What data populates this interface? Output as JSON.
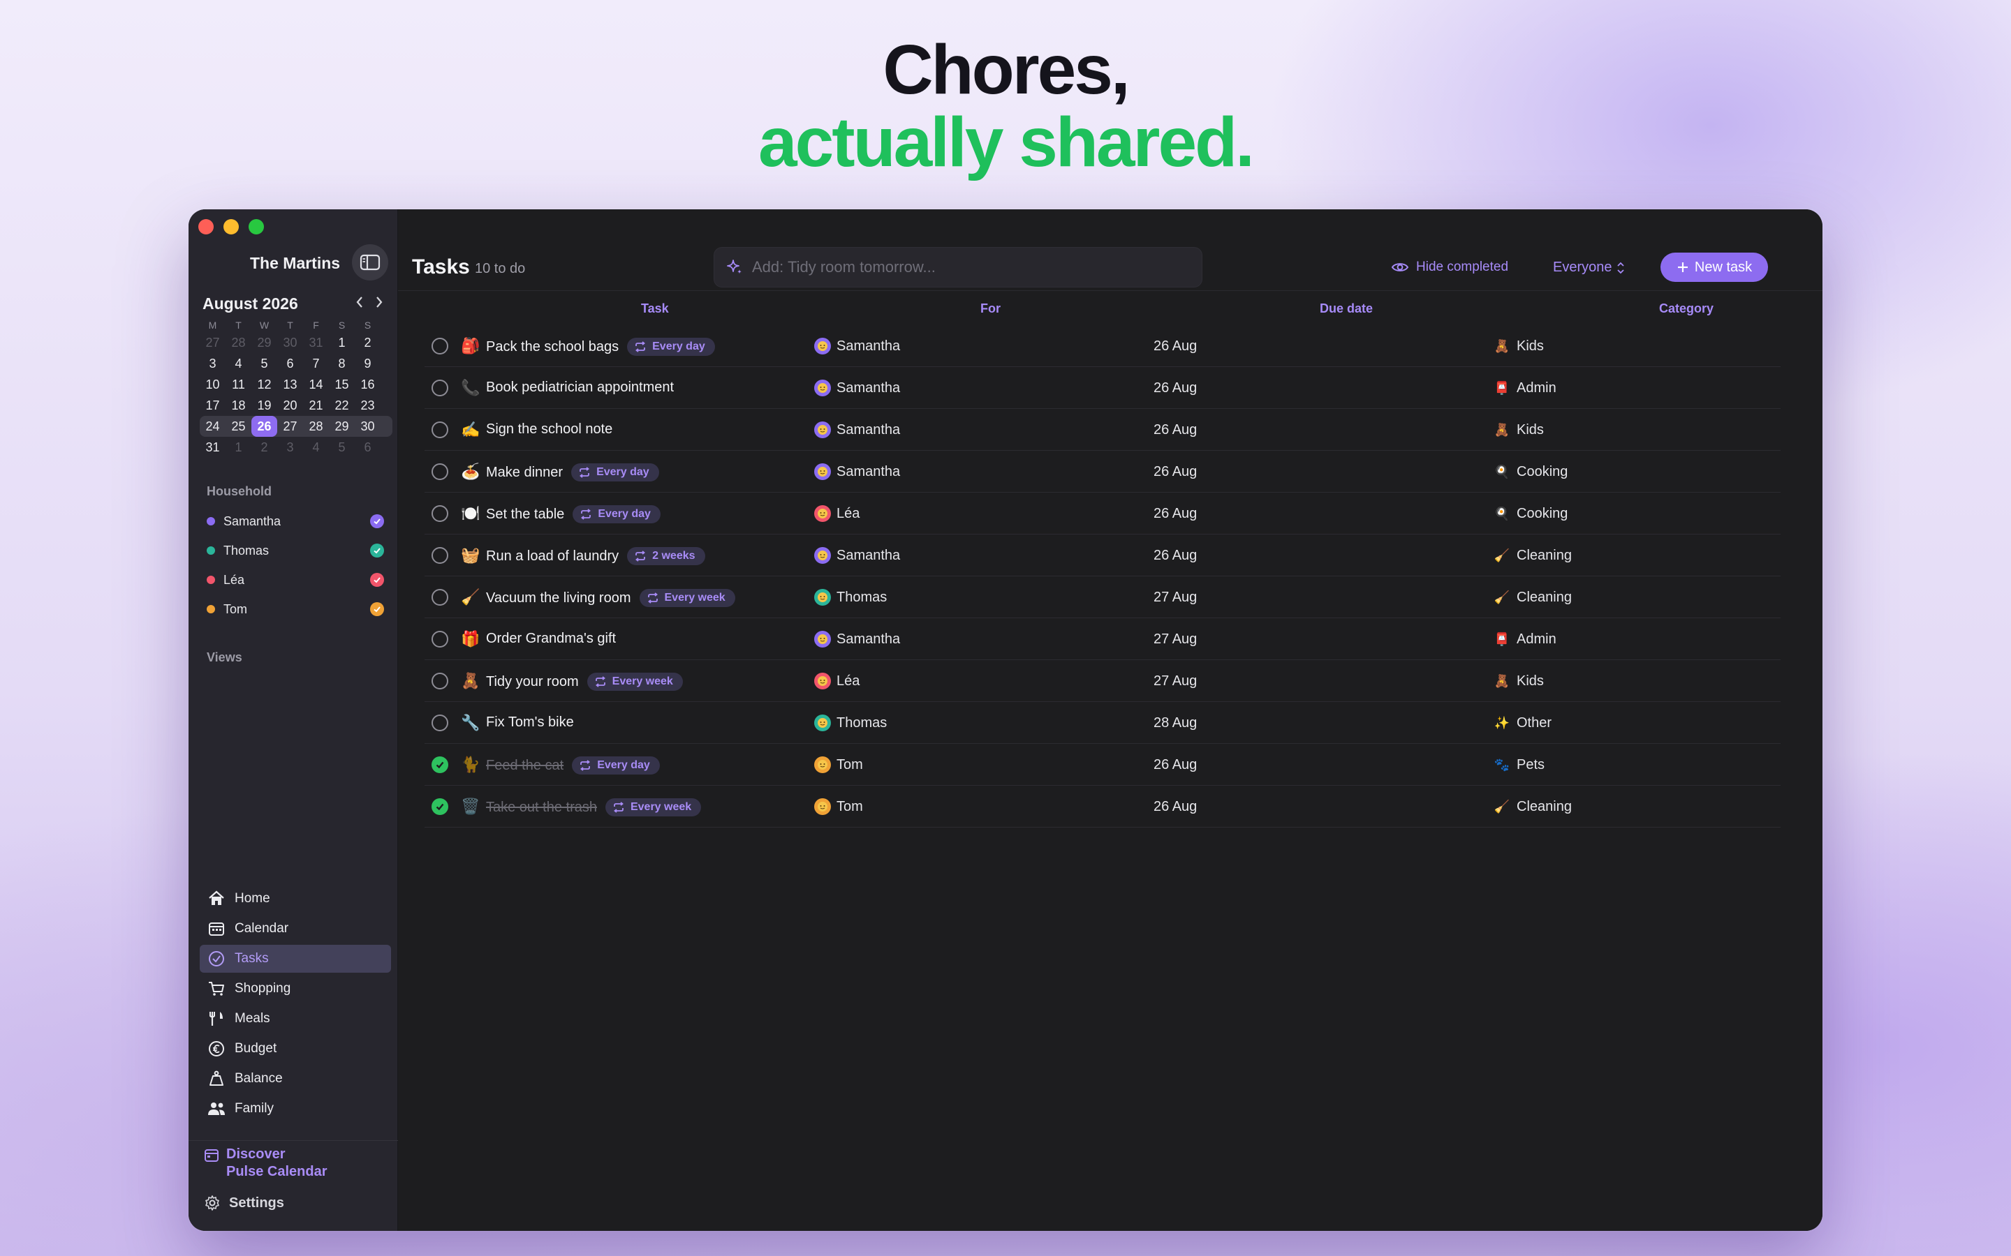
{
  "headline": {
    "line1": "Chores,",
    "line2": "actually shared."
  },
  "sidebar": {
    "household_name": "The Martins",
    "calendar": {
      "month_label": "August 2026",
      "weekdays": [
        "M",
        "T",
        "W",
        "T",
        "F",
        "S",
        "S"
      ],
      "weeks": [
        [
          "27",
          "28",
          "29",
          "30",
          "31",
          "1",
          "2"
        ],
        [
          "3",
          "4",
          "5",
          "6",
          "7",
          "8",
          "9"
        ],
        [
          "10",
          "11",
          "12",
          "13",
          "14",
          "15",
          "16"
        ],
        [
          "17",
          "18",
          "19",
          "20",
          "21",
          "22",
          "23"
        ],
        [
          "24",
          "25",
          "26",
          "27",
          "28",
          "29",
          "30"
        ],
        [
          "31",
          "1",
          "2",
          "3",
          "4",
          "5",
          "6"
        ]
      ],
      "today": "26"
    },
    "household_label": "Household",
    "members": [
      {
        "name": "Samantha",
        "color": "#8b6cf2"
      },
      {
        "name": "Thomas",
        "color": "#2bb59a"
      },
      {
        "name": "Léa",
        "color": "#f2556b"
      },
      {
        "name": "Tom",
        "color": "#f0a236"
      }
    ],
    "views_label": "Views",
    "views": [
      {
        "label": "Home",
        "icon": "home-icon"
      },
      {
        "label": "Calendar",
        "icon": "calendar-icon"
      },
      {
        "label": "Tasks",
        "icon": "tasks-icon",
        "active": true
      },
      {
        "label": "Shopping",
        "icon": "cart-icon"
      },
      {
        "label": "Meals",
        "icon": "utensils-icon"
      },
      {
        "label": "Budget",
        "icon": "euro-icon"
      },
      {
        "label": "Balance",
        "icon": "scale-icon"
      },
      {
        "label": "Family",
        "icon": "people-icon"
      }
    ],
    "discover": {
      "line1": "Discover",
      "line2": "Pulse Calendar"
    },
    "settings_label": "Settings"
  },
  "toolbar": {
    "title": "Tasks",
    "count": "10 to do",
    "add_placeholder": "Add: Tidy room tomorrow...",
    "hide_completed": "Hide completed",
    "filter": "Everyone",
    "new_task": "New task"
  },
  "columns": {
    "task": "Task",
    "for": "For",
    "due": "Due date",
    "category": "Category"
  },
  "tasks": [
    {
      "emoji": "🎒",
      "title": "Pack the school bags",
      "repeat": "Every day",
      "assignee": "Samantha",
      "avatar_color": "#8b6cf2",
      "due": "26 Aug",
      "category": "Kids",
      "category_emoji": "🧸",
      "done": false
    },
    {
      "emoji": "📞",
      "title": "Book pediatrician appointment",
      "repeat": "",
      "assignee": "Samantha",
      "avatar_color": "#8b6cf2",
      "due": "26 Aug",
      "category": "Admin",
      "category_emoji": "📮",
      "done": false
    },
    {
      "emoji": "✍️",
      "title": "Sign the school note",
      "repeat": "",
      "assignee": "Samantha",
      "avatar_color": "#8b6cf2",
      "due": "26 Aug",
      "category": "Kids",
      "category_emoji": "🧸",
      "done": false
    },
    {
      "emoji": "🍝",
      "title": "Make dinner",
      "repeat": "Every day",
      "assignee": "Samantha",
      "avatar_color": "#8b6cf2",
      "due": "26 Aug",
      "category": "Cooking",
      "category_emoji": "🍳",
      "done": false
    },
    {
      "emoji": "🍽️",
      "title": "Set the table",
      "repeat": "Every day",
      "assignee": "Léa",
      "avatar_color": "#f2556b",
      "due": "26 Aug",
      "category": "Cooking",
      "category_emoji": "🍳",
      "done": false
    },
    {
      "emoji": "🧺",
      "title": "Run a load of laundry",
      "repeat": "2 weeks",
      "assignee": "Samantha",
      "avatar_color": "#8b6cf2",
      "due": "26 Aug",
      "category": "Cleaning",
      "category_emoji": "🧹",
      "done": false
    },
    {
      "emoji": "🧹",
      "title": "Vacuum the living room",
      "repeat": "Every week",
      "assignee": "Thomas",
      "avatar_color": "#2bb59a",
      "due": "27 Aug",
      "category": "Cleaning",
      "category_emoji": "🧹",
      "done": false
    },
    {
      "emoji": "🎁",
      "title": "Order Grandma's gift",
      "repeat": "",
      "assignee": "Samantha",
      "avatar_color": "#8b6cf2",
      "due": "27 Aug",
      "category": "Admin",
      "category_emoji": "📮",
      "done": false
    },
    {
      "emoji": "🧸",
      "title": "Tidy your room",
      "repeat": "Every week",
      "assignee": "Léa",
      "avatar_color": "#f2556b",
      "due": "27 Aug",
      "category": "Kids",
      "category_emoji": "🧸",
      "done": false
    },
    {
      "emoji": "🔧",
      "title": "Fix Tom's bike",
      "repeat": "",
      "assignee": "Thomas",
      "avatar_color": "#2bb59a",
      "due": "28 Aug",
      "category": "Other",
      "category_emoji": "✨",
      "done": false
    },
    {
      "emoji": "🐈",
      "title": "Feed the cat",
      "repeat": "Every day",
      "assignee": "Tom",
      "avatar_color": "#f0a236",
      "due": "26 Aug",
      "category": "Pets",
      "category_emoji": "🐾",
      "done": true
    },
    {
      "emoji": "🗑️",
      "title": "Take out the trash",
      "repeat": "Every week",
      "assignee": "Tom",
      "avatar_color": "#f0a236",
      "due": "26 Aug",
      "category": "Cleaning",
      "category_emoji": "🧹",
      "done": true
    }
  ]
}
